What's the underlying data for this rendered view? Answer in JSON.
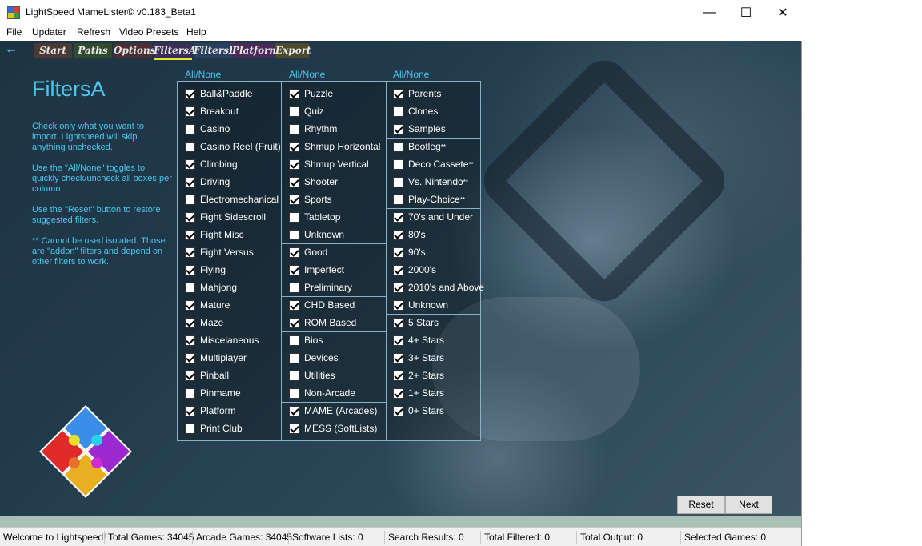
{
  "window": {
    "title": "LightSpeed MameLister© v0.183_Beta1",
    "minimize": "—",
    "maximize": "☐",
    "close": "✕",
    "icon_colors": [
      "#2f6fd0",
      "#e0402a",
      "#e8c020",
      "#30a040"
    ]
  },
  "menu": [
    "File",
    "Updater",
    "Refresh",
    "Video Presets",
    "Help"
  ],
  "nav": {
    "back": "←",
    "tabs": [
      {
        "label": "Start",
        "color": "#4a3a34"
      },
      {
        "label": "Paths",
        "color": "#2f4a2c"
      },
      {
        "label": "Options",
        "color": "#4a2f34"
      },
      {
        "label": "FiltersA",
        "color": "#3a2e56"
      },
      {
        "label": "FiltersB",
        "color": "#2a3f5e"
      },
      {
        "label": "Platform",
        "color": "#4a2a56"
      },
      {
        "label": "Export",
        "color": "#4a4a2c"
      }
    ],
    "active_tab": "FiltersA",
    "underline_color": "#e6e62a"
  },
  "page": {
    "title": "FiltersA",
    "help": [
      "Check only what you want to import. Lightspeed will skip anything unchecked.",
      "Use the \"All/None\" toggles to quickly check/uncheck all boxes per column.",
      "Use the \"Reset\" button to restore suggested filters.",
      "** Cannot be used isolated. Those are \"addon\" filters and depend on other filters to work."
    ]
  },
  "allnone": {
    "col1": "All/None",
    "col2": "All/None",
    "col3": "All/None"
  },
  "col1": [
    {
      "label": "Ball&Paddle",
      "checked": true
    },
    {
      "label": "Breakout",
      "checked": true
    },
    {
      "label": "Casino",
      "checked": false
    },
    {
      "label": "Casino Reel (Fruit)",
      "checked": false
    },
    {
      "label": "Climbing",
      "checked": true
    },
    {
      "label": "Driving",
      "checked": true
    },
    {
      "label": "Electromechanical",
      "checked": false
    },
    {
      "label": "Fight Sidescroll",
      "checked": true
    },
    {
      "label": "Fight Misc",
      "checked": true
    },
    {
      "label": "Fight Versus",
      "checked": true
    },
    {
      "label": "Flying",
      "checked": true
    },
    {
      "label": "Mahjong",
      "checked": false
    },
    {
      "label": "Mature",
      "checked": true
    },
    {
      "label": "Maze",
      "checked": true
    },
    {
      "label": "Miscelaneous",
      "checked": true
    },
    {
      "label": "Multiplayer",
      "checked": true
    },
    {
      "label": "Pinball",
      "checked": true
    },
    {
      "label": "Pinmame",
      "checked": false
    },
    {
      "label": "Platform",
      "checked": true
    },
    {
      "label": "Print Club",
      "checked": false
    }
  ],
  "col2": [
    {
      "label": "Puzzle",
      "checked": true
    },
    {
      "label": "Quiz",
      "checked": false
    },
    {
      "label": "Rhythm",
      "checked": false
    },
    {
      "label": "Shmup Horizontal",
      "checked": true
    },
    {
      "label": "Shmup Vertical",
      "checked": true
    },
    {
      "label": "Shooter",
      "checked": true
    },
    {
      "label": "Sports",
      "checked": true
    },
    {
      "label": "Tabletop",
      "checked": false
    },
    {
      "label": "Unknown",
      "checked": false
    },
    {
      "label": "Good",
      "checked": true
    },
    {
      "label": "Imperfect",
      "checked": true
    },
    {
      "label": "Preliminary",
      "checked": false
    },
    {
      "label": "CHD Based",
      "checked": true
    },
    {
      "label": "ROM Based",
      "checked": true
    },
    {
      "label": "Bios",
      "checked": false
    },
    {
      "label": "Devices",
      "checked": false
    },
    {
      "label": "Utilities",
      "checked": false
    },
    {
      "label": "Non-Arcade",
      "checked": false
    },
    {
      "label": "MAME (Arcades)",
      "checked": true
    },
    {
      "label": "MESS (SoftLists)",
      "checked": true
    }
  ],
  "col3": [
    {
      "label": "Parents",
      "checked": true
    },
    {
      "label": "Clones",
      "checked": false
    },
    {
      "label": "Samples",
      "checked": true
    },
    {
      "label": "Bootleg",
      "addon": "**",
      "checked": false
    },
    {
      "label": "Deco Cassete",
      "addon": "**",
      "checked": false
    },
    {
      "label": "Vs. Nintendo",
      "addon": "**",
      "checked": false
    },
    {
      "label": "Play-Choice",
      "addon": "**",
      "checked": false
    },
    {
      "label": "70's and Under",
      "checked": true
    },
    {
      "label": "80's",
      "checked": true
    },
    {
      "label": "90's",
      "checked": true
    },
    {
      "label": "2000's",
      "checked": true
    },
    {
      "label": "2010's and Above",
      "checked": true
    },
    {
      "label": "Unknown",
      "checked": true
    },
    {
      "label": "5 Stars",
      "checked": true
    },
    {
      "label": "4+ Stars",
      "checked": true
    },
    {
      "label": "3+ Stars",
      "checked": true
    },
    {
      "label": "2+ Stars",
      "checked": true
    },
    {
      "label": "1+ Stars",
      "checked": true
    },
    {
      "label": "0+ Stars",
      "checked": true
    }
  ],
  "buttons": {
    "reset": "Reset",
    "next": "Next"
  },
  "status": [
    "Welcome to Lightspeed!",
    "Total Games: 34045",
    "Arcade Games: 34045",
    "Software Lists: 0",
    "Search Results: 0",
    "Total Filtered: 0",
    "Total Output: 0",
    "Selected Games: 0"
  ],
  "logo_colors": [
    "#3a8ee8",
    "#9a2ad0",
    "#e02a2a",
    "#e8b020"
  ]
}
